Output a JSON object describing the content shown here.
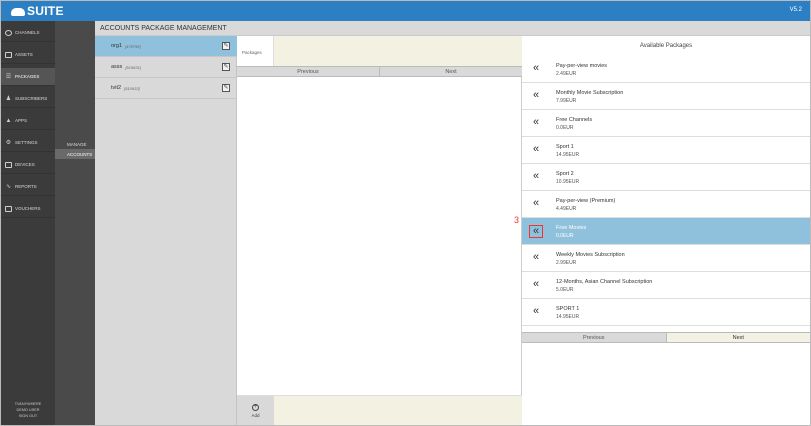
{
  "app": {
    "logo_small": "CLOUD",
    "logo_text": "SUITE",
    "version": "V5.2"
  },
  "sidebar": {
    "items": [
      {
        "label": "CHANNELS",
        "icon": "channels-icon"
      },
      {
        "label": "ASSETS",
        "icon": "assets-icon"
      },
      {
        "label": "PACKAGES",
        "icon": "packages-icon",
        "active": true
      },
      {
        "label": "SUBSCRIBERS",
        "icon": "subscribers-icon"
      },
      {
        "label": "APPS",
        "icon": "apps-icon"
      },
      {
        "label": "SETTINGS",
        "icon": "settings-icon"
      },
      {
        "label": "DEVICES",
        "icon": "devices-icon"
      },
      {
        "label": "REPORTS",
        "icon": "reports-icon"
      },
      {
        "label": "VOUCHERS",
        "icon": "vouchers-icon"
      }
    ],
    "footer": [
      "TVANYWHERE",
      "DEMO USER",
      "SIGN OUT"
    ]
  },
  "submenu": {
    "items": [
      {
        "label": "MANAGE"
      },
      {
        "label": "ACCOUNTS",
        "active": true
      }
    ]
  },
  "page": {
    "title": "ACCOUNTS PACKAGE MANAGEMENT"
  },
  "accounts": [
    {
      "name": "org1",
      "id": "[478798]",
      "selected": true
    },
    {
      "name": "asss",
      "id": "[519831]"
    },
    {
      "name": "tvit2",
      "id": "[510933]"
    }
  ],
  "packages_panel": {
    "tab_label": "Packages",
    "previous_label": "Previous",
    "next_label": "Next",
    "add_label": "Add"
  },
  "available": {
    "title": "Available Packages",
    "previous_label": "Previous",
    "next_label": "Next",
    "items": [
      {
        "name": "Pay-per-view movies",
        "price": "2.49EUR"
      },
      {
        "name": "Monthly Movie Subscription",
        "price": "7.99EUR"
      },
      {
        "name": "Free Channels",
        "price": "0.0EUR"
      },
      {
        "name": "Sport 1",
        "price": "14.95EUR"
      },
      {
        "name": "Sport 2",
        "price": "10.95EUR"
      },
      {
        "name": "Pay-per-view (Premium)",
        "price": "4.49EUR"
      },
      {
        "name": "Free Movies",
        "price": "0.0EUR",
        "selected": true
      },
      {
        "name": "Weekly Movies Subscription",
        "price": "2.99EUR"
      },
      {
        "name": "12-Months, Asian Channel Subscription",
        "price": "5.0EUR"
      },
      {
        "name": "SPORT 1",
        "price": "14.95EUR"
      }
    ]
  },
  "annotation": {
    "step": "3"
  },
  "colors": {
    "topbar": "#2d7fc4",
    "sidebar": "#3b3b3b",
    "selected_row": "#8fc1dc",
    "highlight_box": "#ee3333"
  }
}
